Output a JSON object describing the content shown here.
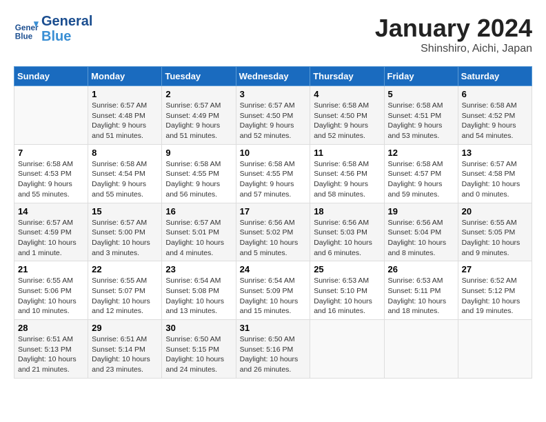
{
  "header": {
    "logo_line1": "General",
    "logo_line2": "Blue",
    "month_title": "January 2024",
    "subtitle": "Shinshiro, Aichi, Japan"
  },
  "columns": [
    "Sunday",
    "Monday",
    "Tuesday",
    "Wednesday",
    "Thursday",
    "Friday",
    "Saturday"
  ],
  "weeks": [
    [
      {
        "day": "",
        "info": ""
      },
      {
        "day": "1",
        "info": "Sunrise: 6:57 AM\nSunset: 4:48 PM\nDaylight: 9 hours\nand 51 minutes."
      },
      {
        "day": "2",
        "info": "Sunrise: 6:57 AM\nSunset: 4:49 PM\nDaylight: 9 hours\nand 51 minutes."
      },
      {
        "day": "3",
        "info": "Sunrise: 6:57 AM\nSunset: 4:50 PM\nDaylight: 9 hours\nand 52 minutes."
      },
      {
        "day": "4",
        "info": "Sunrise: 6:58 AM\nSunset: 4:50 PM\nDaylight: 9 hours\nand 52 minutes."
      },
      {
        "day": "5",
        "info": "Sunrise: 6:58 AM\nSunset: 4:51 PM\nDaylight: 9 hours\nand 53 minutes."
      },
      {
        "day": "6",
        "info": "Sunrise: 6:58 AM\nSunset: 4:52 PM\nDaylight: 9 hours\nand 54 minutes."
      }
    ],
    [
      {
        "day": "7",
        "info": "Sunrise: 6:58 AM\nSunset: 4:53 PM\nDaylight: 9 hours\nand 55 minutes."
      },
      {
        "day": "8",
        "info": "Sunrise: 6:58 AM\nSunset: 4:54 PM\nDaylight: 9 hours\nand 55 minutes."
      },
      {
        "day": "9",
        "info": "Sunrise: 6:58 AM\nSunset: 4:55 PM\nDaylight: 9 hours\nand 56 minutes."
      },
      {
        "day": "10",
        "info": "Sunrise: 6:58 AM\nSunset: 4:55 PM\nDaylight: 9 hours\nand 57 minutes."
      },
      {
        "day": "11",
        "info": "Sunrise: 6:58 AM\nSunset: 4:56 PM\nDaylight: 9 hours\nand 58 minutes."
      },
      {
        "day": "12",
        "info": "Sunrise: 6:58 AM\nSunset: 4:57 PM\nDaylight: 9 hours\nand 59 minutes."
      },
      {
        "day": "13",
        "info": "Sunrise: 6:57 AM\nSunset: 4:58 PM\nDaylight: 10 hours\nand 0 minutes."
      }
    ],
    [
      {
        "day": "14",
        "info": "Sunrise: 6:57 AM\nSunset: 4:59 PM\nDaylight: 10 hours\nand 1 minute."
      },
      {
        "day": "15",
        "info": "Sunrise: 6:57 AM\nSunset: 5:00 PM\nDaylight: 10 hours\nand 3 minutes."
      },
      {
        "day": "16",
        "info": "Sunrise: 6:57 AM\nSunset: 5:01 PM\nDaylight: 10 hours\nand 4 minutes."
      },
      {
        "day": "17",
        "info": "Sunrise: 6:56 AM\nSunset: 5:02 PM\nDaylight: 10 hours\nand 5 minutes."
      },
      {
        "day": "18",
        "info": "Sunrise: 6:56 AM\nSunset: 5:03 PM\nDaylight: 10 hours\nand 6 minutes."
      },
      {
        "day": "19",
        "info": "Sunrise: 6:56 AM\nSunset: 5:04 PM\nDaylight: 10 hours\nand 8 minutes."
      },
      {
        "day": "20",
        "info": "Sunrise: 6:55 AM\nSunset: 5:05 PM\nDaylight: 10 hours\nand 9 minutes."
      }
    ],
    [
      {
        "day": "21",
        "info": "Sunrise: 6:55 AM\nSunset: 5:06 PM\nDaylight: 10 hours\nand 10 minutes."
      },
      {
        "day": "22",
        "info": "Sunrise: 6:55 AM\nSunset: 5:07 PM\nDaylight: 10 hours\nand 12 minutes."
      },
      {
        "day": "23",
        "info": "Sunrise: 6:54 AM\nSunset: 5:08 PM\nDaylight: 10 hours\nand 13 minutes."
      },
      {
        "day": "24",
        "info": "Sunrise: 6:54 AM\nSunset: 5:09 PM\nDaylight: 10 hours\nand 15 minutes."
      },
      {
        "day": "25",
        "info": "Sunrise: 6:53 AM\nSunset: 5:10 PM\nDaylight: 10 hours\nand 16 minutes."
      },
      {
        "day": "26",
        "info": "Sunrise: 6:53 AM\nSunset: 5:11 PM\nDaylight: 10 hours\nand 18 minutes."
      },
      {
        "day": "27",
        "info": "Sunrise: 6:52 AM\nSunset: 5:12 PM\nDaylight: 10 hours\nand 19 minutes."
      }
    ],
    [
      {
        "day": "28",
        "info": "Sunrise: 6:51 AM\nSunset: 5:13 PM\nDaylight: 10 hours\nand 21 minutes."
      },
      {
        "day": "29",
        "info": "Sunrise: 6:51 AM\nSunset: 5:14 PM\nDaylight: 10 hours\nand 23 minutes."
      },
      {
        "day": "30",
        "info": "Sunrise: 6:50 AM\nSunset: 5:15 PM\nDaylight: 10 hours\nand 24 minutes."
      },
      {
        "day": "31",
        "info": "Sunrise: 6:50 AM\nSunset: 5:16 PM\nDaylight: 10 hours\nand 26 minutes."
      },
      {
        "day": "",
        "info": ""
      },
      {
        "day": "",
        "info": ""
      },
      {
        "day": "",
        "info": ""
      }
    ]
  ]
}
